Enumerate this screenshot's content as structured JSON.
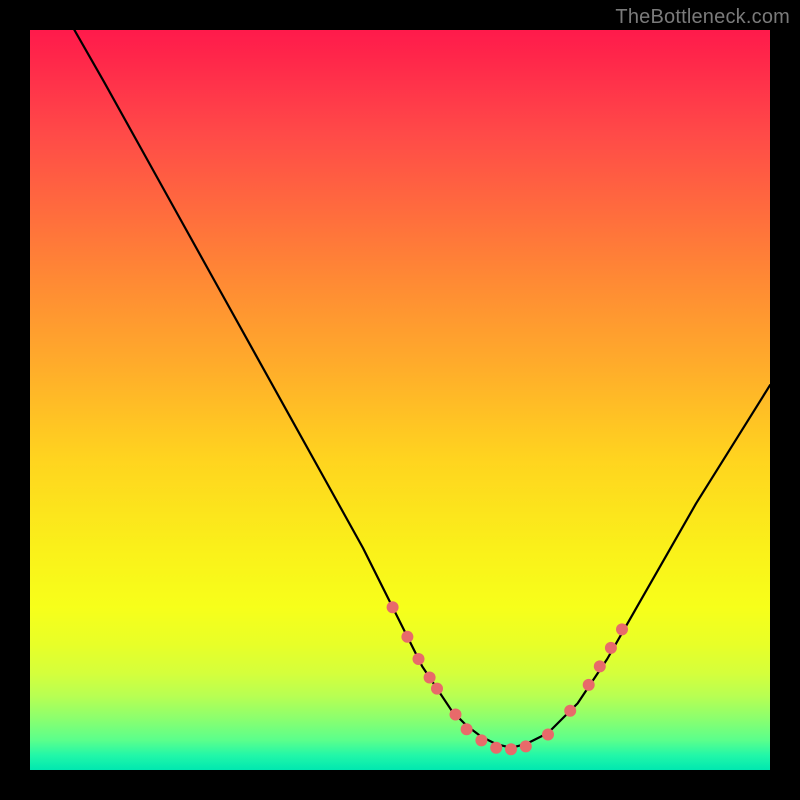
{
  "watermark": "TheBottleneck.com",
  "chart_data": {
    "type": "line",
    "title": "",
    "xlabel": "",
    "ylabel": "",
    "xlim": [
      0,
      100
    ],
    "ylim": [
      0,
      100
    ],
    "series": [
      {
        "name": "bottleneck-curve",
        "x": [
          6,
          10,
          15,
          20,
          25,
          30,
          35,
          40,
          45,
          48,
          51,
          53,
          55,
          57,
          59,
          61,
          63,
          65,
          67,
          70,
          74,
          78,
          82,
          86,
          90,
          95,
          100
        ],
        "y": [
          100,
          93,
          84,
          75,
          66,
          57,
          48,
          39,
          30,
          24,
          18,
          14,
          11,
          8,
          6,
          4.5,
          3.5,
          3,
          3.5,
          5,
          9,
          15,
          22,
          29,
          36,
          44,
          52
        ]
      }
    ],
    "points": {
      "name": "highlighted-points",
      "color": "#e86a6a",
      "x": [
        49,
        51,
        52.5,
        54,
        55,
        57.5,
        59,
        61,
        63,
        65,
        67,
        70,
        73,
        75.5,
        77,
        78.5,
        80
      ],
      "y": [
        22,
        18,
        15,
        12.5,
        11,
        7.5,
        5.5,
        4,
        3,
        2.8,
        3.2,
        4.8,
        8,
        11.5,
        14,
        16.5,
        19
      ]
    },
    "background_gradient": {
      "top": "#ff1a4b",
      "mid": "#ffd41f",
      "bottom": "#00e8b0"
    }
  }
}
